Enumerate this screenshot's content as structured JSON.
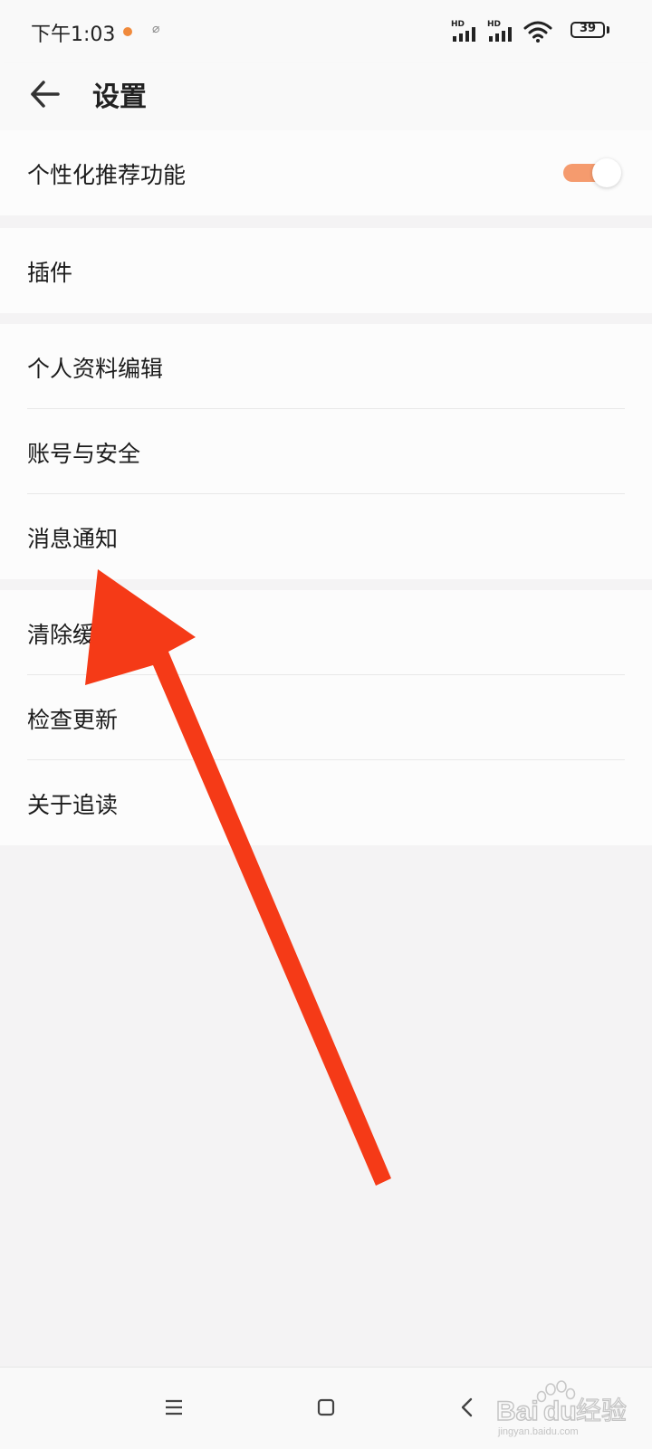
{
  "status_bar": {
    "time": "下午1:03",
    "signal_1_label": "HD",
    "signal_2_label": "HD",
    "battery_level": "39",
    "notification_icon": "app-notification-icon",
    "link_icon": "link-icon"
  },
  "header": {
    "title": "设置",
    "back_icon": "back-arrow-icon"
  },
  "settings": {
    "personalized": {
      "label": "个性化推荐功能",
      "toggle_on": true
    },
    "plugins": {
      "label": "插件"
    },
    "group2": [
      {
        "label": "个人资料编辑"
      },
      {
        "label": "账号与安全"
      },
      {
        "label": "消息通知"
      }
    ],
    "group3": [
      {
        "label": "清除缓存"
      },
      {
        "label": "检查更新"
      },
      {
        "label": "关于追读"
      }
    ]
  },
  "nav_bar": {
    "menu_icon": "menu-icon",
    "home_icon": "home-square-icon",
    "back_icon": "back-chevron-icon"
  },
  "watermark": {
    "brand_text": "Bai",
    "brand_text2": "du",
    "brand_suffix": "经验",
    "url": "jingyan.baidu.com"
  },
  "colors": {
    "accent": "#f59b6e",
    "annotation_arrow": "#f53a17",
    "background": "#f4f3f4",
    "card": "#fcfcfc"
  }
}
